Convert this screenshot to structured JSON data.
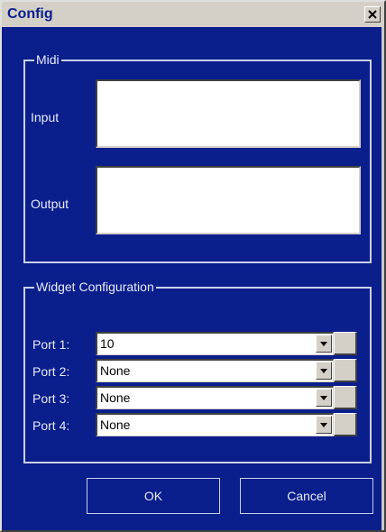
{
  "window": {
    "title": "Config"
  },
  "midi": {
    "legend": "Midi",
    "input_label": "Input",
    "output_label": "Output"
  },
  "widget": {
    "legend": "Widget Configuration",
    "ports": [
      {
        "label": "Port 1:",
        "value": "10"
      },
      {
        "label": "Port 2:",
        "value": "None"
      },
      {
        "label": "Port 3:",
        "value": "None"
      },
      {
        "label": "Port 4:",
        "value": "None"
      }
    ]
  },
  "buttons": {
    "ok": "OK",
    "cancel": "Cancel"
  },
  "icons": {
    "close": "close-icon",
    "dropdown": "chevron-down-icon"
  }
}
